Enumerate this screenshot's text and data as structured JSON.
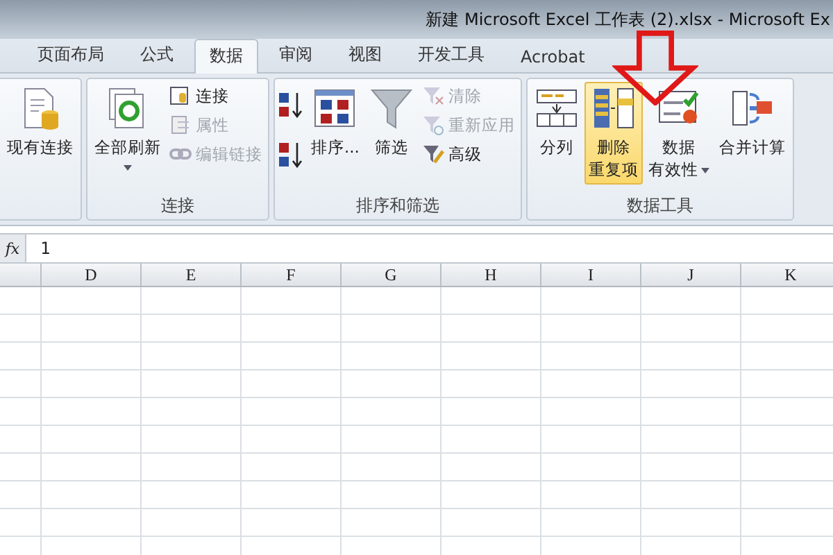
{
  "title_bar": {
    "title": "新建 Microsoft Excel 工作表 (2).xlsx - Microsoft Ex"
  },
  "tabs": [
    {
      "label": "页面布局",
      "selected": false
    },
    {
      "label": "公式",
      "selected": false
    },
    {
      "label": "数据",
      "selected": true
    },
    {
      "label": "审阅",
      "selected": false
    },
    {
      "label": "视图",
      "selected": false
    },
    {
      "label": "开发工具",
      "selected": false
    },
    {
      "label": "Acrobat",
      "selected": false
    }
  ],
  "ribbon": {
    "groups": [
      {
        "items": [
          {
            "kind": "large",
            "lines": [
              "现有连接"
            ],
            "dropdown": false,
            "disabled": false,
            "highlighted": false
          }
        ]
      },
      {
        "label": "连接",
        "items": [
          {
            "kind": "large",
            "lines": [
              "全部刷新"
            ],
            "dropdown": true,
            "disabled": false,
            "highlighted": false
          },
          {
            "kind": "small",
            "lines": [
              "连接"
            ],
            "dropdown": false,
            "disabled": false,
            "highlighted": false
          },
          {
            "kind": "small",
            "lines": [
              "属性"
            ],
            "dropdown": false,
            "disabled": true,
            "highlighted": false
          },
          {
            "kind": "small",
            "lines": [
              "编辑链接"
            ],
            "dropdown": false,
            "disabled": true,
            "highlighted": false
          }
        ]
      },
      {
        "label": "排序和筛选",
        "items": [
          {
            "kind": "sort-pair",
            "dropdown": false,
            "disabled": false,
            "highlighted": false
          },
          {
            "kind": "large",
            "lines": [
              "排序..."
            ],
            "dropdown": false,
            "disabled": false,
            "highlighted": false
          },
          {
            "kind": "large",
            "lines": [
              "筛选"
            ],
            "dropdown": false,
            "disabled": false,
            "highlighted": false
          },
          {
            "kind": "small",
            "lines": [
              "清除"
            ],
            "dropdown": false,
            "disabled": true,
            "highlighted": false
          },
          {
            "kind": "small",
            "lines": [
              "重新应用"
            ],
            "dropdown": false,
            "disabled": true,
            "highlighted": false
          },
          {
            "kind": "small",
            "lines": [
              "高级"
            ],
            "dropdown": false,
            "disabled": false,
            "highlighted": false
          }
        ]
      },
      {
        "label": "数据工具",
        "items": [
          {
            "kind": "large",
            "lines": [
              "分列"
            ],
            "dropdown": false,
            "disabled": false,
            "highlighted": false
          },
          {
            "kind": "large",
            "lines": [
              "删除",
              "重复项"
            ],
            "dropdown": false,
            "disabled": false,
            "highlighted": true
          },
          {
            "kind": "large",
            "lines": [
              "数据",
              "有效性"
            ],
            "dropdown": true,
            "disabled": false,
            "highlighted": false
          },
          {
            "kind": "large",
            "lines": [
              "合并计算"
            ],
            "dropdown": false,
            "disabled": false,
            "highlighted": false
          }
        ]
      }
    ]
  },
  "formula_bar": {
    "fx": "fx",
    "value": "1"
  },
  "sheet": {
    "columns": [
      "D",
      "E",
      "F",
      "G",
      "H",
      "I",
      "J",
      "K"
    ]
  }
}
